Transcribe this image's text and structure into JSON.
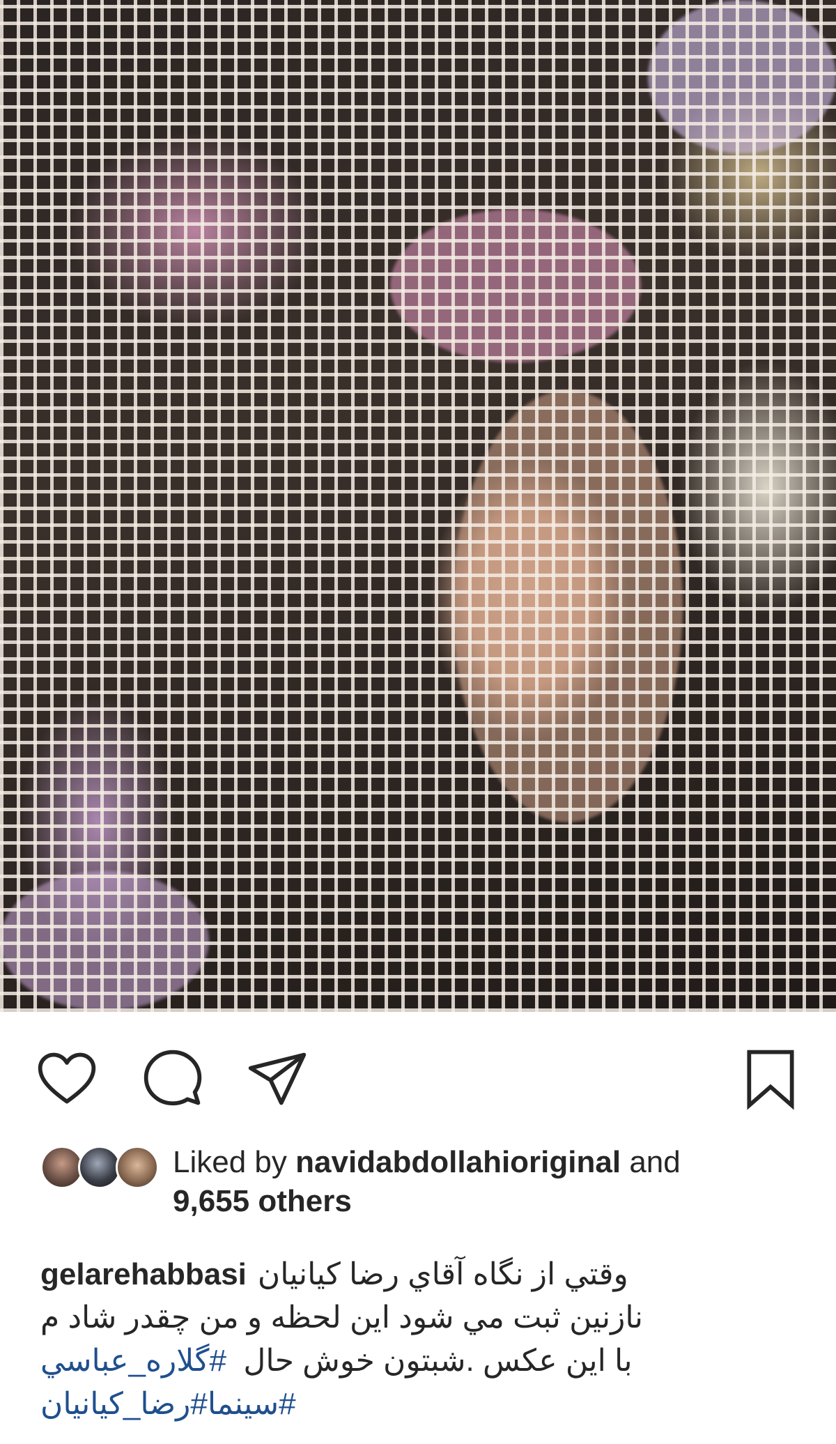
{
  "post": {
    "likes": {
      "prefix": "Liked by",
      "user": "navidabdollahioriginal",
      "conjunction": "and",
      "others": "9,655 others"
    },
    "caption": {
      "username": "gelarehabbasi",
      "line1": "وقتي  از نگاه  آقاي رضا كيانيان",
      "line2": "نازنين  ثبت مي شود اين  لحظه  و من  چقدر شاد م",
      "line3_text": "با اين عكس .شبتون خوش حال",
      "line3_hashtag": "#گلاره_عباسي",
      "line4": "#سينما#رضا_كيانيان"
    },
    "icons": {
      "like": "heart-icon",
      "comment": "comment-bubble-icon",
      "share": "paper-plane-icon",
      "save": "bookmark-icon"
    },
    "colors": {
      "hashtag": "#1f4f8e",
      "text": "#262626",
      "icon": "#262626"
    }
  }
}
